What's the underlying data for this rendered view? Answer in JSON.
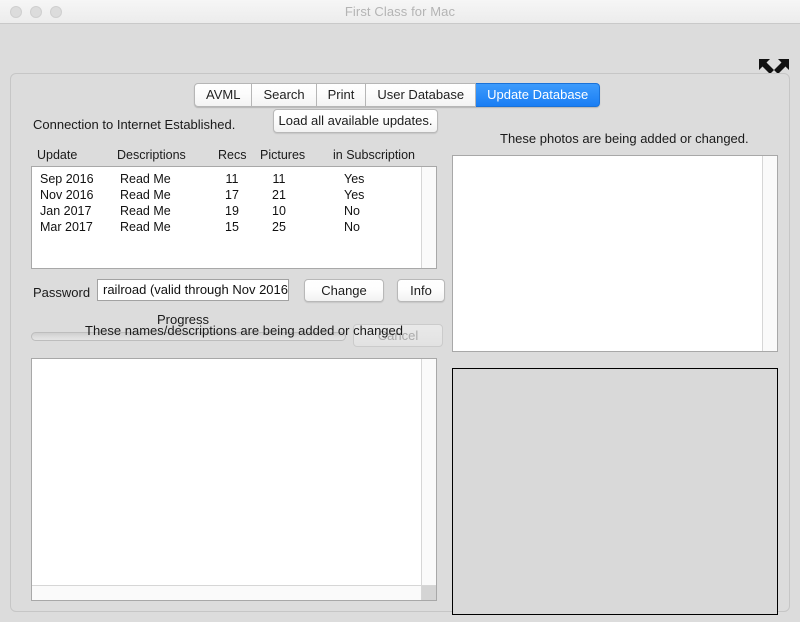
{
  "window": {
    "title": "First Class for Mac",
    "traffic_lights": [
      "close",
      "minimize",
      "maximize"
    ],
    "expand_icon": "expand-arrows-icon"
  },
  "tabs": [
    {
      "label": "AVML",
      "selected": false
    },
    {
      "label": "Search",
      "selected": false
    },
    {
      "label": "Print",
      "selected": false
    },
    {
      "label": "User Database",
      "selected": false
    },
    {
      "label": "Update Database",
      "selected": true
    }
  ],
  "status": {
    "connection": "Connection to Internet Established."
  },
  "toolbar": {
    "load_updates_label": "Load all available updates."
  },
  "updates_table": {
    "columns": [
      "Update",
      "Descriptions",
      "Recs",
      "Pictures",
      "in Subscription"
    ],
    "rows": [
      {
        "update": "Sep 2016",
        "description": "Read Me",
        "recs": "11",
        "pictures": "11",
        "subscription": "Yes"
      },
      {
        "update": "Nov 2016",
        "description": "Read Me",
        "recs": "17",
        "pictures": "21",
        "subscription": "Yes"
      },
      {
        "update": "Jan 2017",
        "description": "Read Me",
        "recs": "19",
        "pictures": "10",
        "subscription": "No"
      },
      {
        "update": "Mar 2017",
        "description": "Read Me",
        "recs": "15",
        "pictures": "25",
        "subscription": "No"
      }
    ]
  },
  "password_row": {
    "label": "Password",
    "value": "railroad (valid through Nov 2016)",
    "placeholder": "",
    "change_label": "Change",
    "info_label": "Info"
  },
  "progress": {
    "label": "Progress",
    "percent": 0,
    "cancel_label": "Cancel",
    "cancel_enabled": false
  },
  "names_panel": {
    "title": "These names/descriptions are being added or changed",
    "items": []
  },
  "photos_panel": {
    "title": "These photos are being added or changed.",
    "items": []
  },
  "image_preview": {
    "caption": ""
  },
  "colors": {
    "accent": "#1a7ef4",
    "window_bg": "#dcdcdc",
    "panel_bg": "#dcdcdc",
    "field_bg": "#ffffff",
    "text": "#1a1a1a",
    "title_text": "#b4b4b4"
  }
}
